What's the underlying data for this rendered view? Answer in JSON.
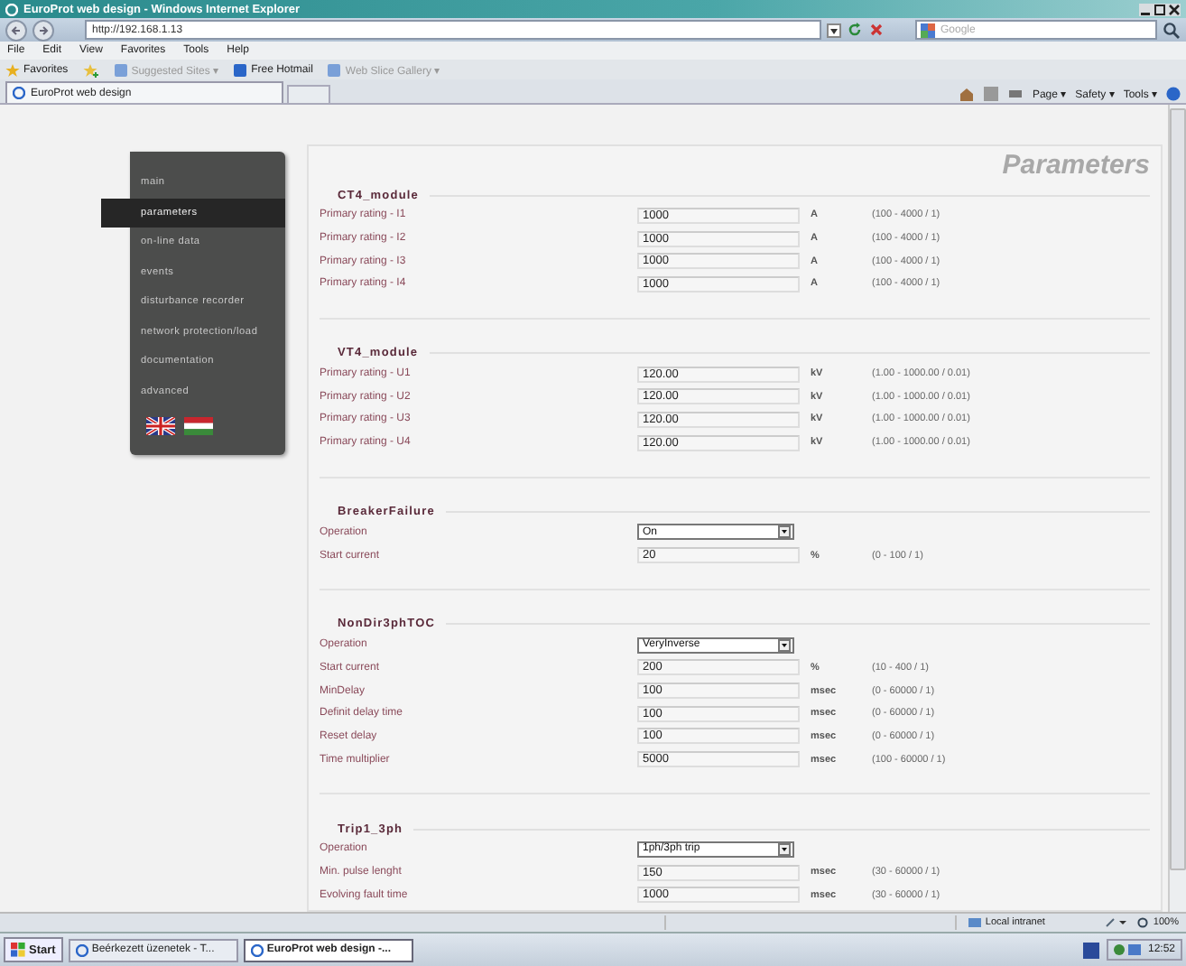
{
  "window": {
    "title": "EuroProt web design - Windows Internet Explorer"
  },
  "address_bar": {
    "url": "http://192.168.1.13",
    "search_placeholder": "Google"
  },
  "menu": [
    "File",
    "Edit",
    "View",
    "Favorites",
    "Tools",
    "Help"
  ],
  "favorites_bar": {
    "label": "Favorites",
    "links": [
      "Suggested Sites ▾",
      "Free Hotmail",
      "Web Slice Gallery ▾"
    ]
  },
  "tab": {
    "title": "EuroProt web design"
  },
  "command_bar": [
    "Page ▾",
    "Safety ▾",
    "Tools ▾"
  ],
  "sidebar": {
    "items": [
      {
        "label": "main",
        "selected": false
      },
      {
        "label": "parameters",
        "selected": true
      },
      {
        "label": "on-line data",
        "selected": false
      },
      {
        "label": "events",
        "selected": false
      },
      {
        "label": "disturbance recorder",
        "selected": false
      },
      {
        "label": "network protection/load",
        "selected": false
      },
      {
        "label": "documentation",
        "selected": false
      },
      {
        "label": "advanced",
        "selected": false
      }
    ],
    "languages": [
      {
        "kind": "uk"
      },
      {
        "kind": "hu"
      }
    ]
  },
  "page_title": "Parameters",
  "sections": [
    {
      "title": "CT4_module",
      "rows": [
        {
          "kind": "input",
          "label": "Primary rating - I1",
          "value": "1000",
          "unit": "A",
          "range": "(100 - 4000 / 1)"
        },
        {
          "kind": "input",
          "label": "Primary rating - I2",
          "value": "1000",
          "unit": "A",
          "range": "(100 - 4000 / 1)"
        },
        {
          "kind": "input",
          "label": "Primary rating - I3",
          "value": "1000",
          "unit": "A",
          "range": "(100 - 4000 / 1)"
        },
        {
          "kind": "input",
          "label": "Primary rating - I4",
          "value": "1000",
          "unit": "A",
          "range": "(100 - 4000 / 1)"
        }
      ]
    },
    {
      "title": "VT4_module",
      "rows": [
        {
          "kind": "input",
          "label": "Primary rating - U1",
          "value": "120.00",
          "unit": "kV",
          "range": "(1.00 - 1000.00 / 0.01)"
        },
        {
          "kind": "input",
          "label": "Primary rating - U2",
          "value": "120.00",
          "unit": "kV",
          "range": "(1.00 - 1000.00 / 0.01)"
        },
        {
          "kind": "input",
          "label": "Primary rating - U3",
          "value": "120.00",
          "unit": "kV",
          "range": "(1.00 - 1000.00 / 0.01)"
        },
        {
          "kind": "input",
          "label": "Primary rating - U4",
          "value": "120.00",
          "unit": "kV",
          "range": "(1.00 - 1000.00 / 0.01)"
        }
      ]
    },
    {
      "title": "BreakerFailure",
      "rows": [
        {
          "kind": "select",
          "label": "Operation",
          "value": "On"
        },
        {
          "kind": "input",
          "label": "Start current",
          "value": "20",
          "unit": "%",
          "range": "(0 - 100 / 1)"
        }
      ]
    },
    {
      "title": "NonDir3phTOC",
      "rows": [
        {
          "kind": "select",
          "label": "Operation",
          "value": "VeryInverse"
        },
        {
          "kind": "input",
          "label": "Start current",
          "value": "200",
          "unit": "%",
          "range": "(10 - 400 / 1)"
        },
        {
          "kind": "input",
          "label": "MinDelay",
          "value": "100",
          "unit": "msec",
          "range": "(0 - 60000 / 1)"
        },
        {
          "kind": "input",
          "label": "Definit delay time",
          "value": "100",
          "unit": "msec",
          "range": "(0 - 60000 / 1)"
        },
        {
          "kind": "input",
          "label": "Reset delay",
          "value": "100",
          "unit": "msec",
          "range": "(0 - 60000 / 1)"
        },
        {
          "kind": "input",
          "label": "Time multiplier",
          "value": "5000",
          "unit": "msec",
          "range": "(100 - 60000 / 1)"
        }
      ]
    },
    {
      "title": "Trip1_3ph",
      "rows": [
        {
          "kind": "select",
          "label": "Operation",
          "value": "1ph/3ph trip"
        },
        {
          "kind": "input",
          "label": "Min. pulse lenght",
          "value": "150",
          "unit": "msec",
          "range": "(30 - 60000 / 1)"
        },
        {
          "kind": "input",
          "label": "Evolving fault time",
          "value": "1000",
          "unit": "msec",
          "range": "(30 - 60000 / 1)"
        }
      ]
    }
  ],
  "status_bar": {
    "zone": "Local intranet",
    "zoom": "100%"
  },
  "taskbar": {
    "start": "Start",
    "tasks": [
      {
        "label": "Beérkezett üzenetek - T...",
        "selected": false
      },
      {
        "label": "EuroProt web design -...",
        "selected": true
      }
    ],
    "clock": "12:52"
  }
}
